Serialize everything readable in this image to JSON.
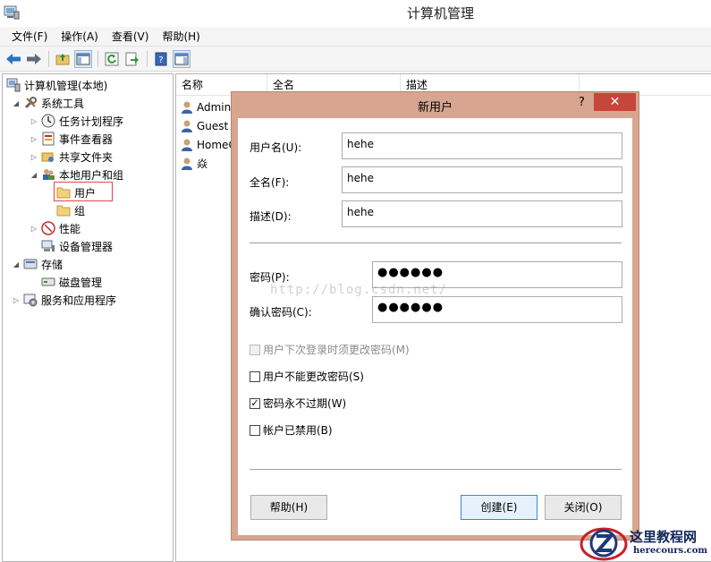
{
  "window": {
    "title": "计算机管理"
  },
  "menu": [
    "文件(F)",
    "操作(A)",
    "查看(V)",
    "帮助(H)"
  ],
  "tree": {
    "root": "计算机管理(本地)",
    "system_tools": "系统工具",
    "task_scheduler": "任务计划程序",
    "event_viewer": "事件查看器",
    "shared_folders": "共享文件夹",
    "local_users_groups": "本地用户和组",
    "users": "用户",
    "groups": "组",
    "performance": "性能",
    "device_manager": "设备管理器",
    "storage": "存储",
    "disk_management": "磁盘管理",
    "services_apps": "服务和应用程序"
  },
  "list": {
    "columns": [
      "名称",
      "全名",
      "描述"
    ],
    "rows": [
      "Admini",
      "Guest",
      "HomeG",
      "焱"
    ]
  },
  "dialog": {
    "title": "新用户",
    "help": "?",
    "close": "✕",
    "username_label": "用户名(U):",
    "username_value": "hehe",
    "fullname_label": "全名(F):",
    "fullname_value": "hehe",
    "desc_label": "描述(D):",
    "desc_value": "hehe",
    "password_label": "密码(P):",
    "password_value": "●●●●●●",
    "confirm_label": "确认密码(C):",
    "confirm_value": "●●●●●●",
    "opt_must_change": "用户下次登录时须更改密码(M)",
    "opt_cannot_change": "用户不能更改密码(S)",
    "opt_never_expires": "密码永不过期(W)",
    "opt_disabled": "帐户已禁用(B)",
    "checked_mark": "✓",
    "btn_help": "帮助(H)",
    "btn_create": "创建(E)",
    "btn_close": "关闭(O)"
  },
  "watermark": "http://blog.csdn.net/",
  "logo": {
    "text": "这里教程网",
    "url": "herecours.com"
  },
  "colors": {
    "dialog_frame": "#d7a590",
    "close_button": "#c7463c",
    "selection_box": "#e04848"
  }
}
